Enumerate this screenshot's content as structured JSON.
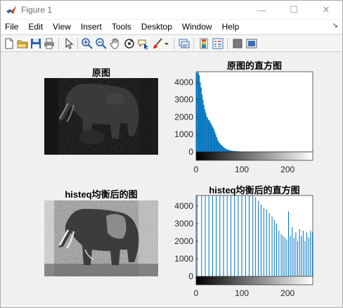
{
  "window": {
    "title": "Figure 1",
    "controls": {
      "minimize": "—",
      "maximize": "☐",
      "close": "✕"
    }
  },
  "menubar": {
    "items": [
      "File",
      "Edit",
      "View",
      "Insert",
      "Tools",
      "Desktop",
      "Window",
      "Help"
    ],
    "dock_arrow": "↘"
  },
  "toolbar": {
    "buttons": [
      "new-figure-icon",
      "open-file-icon",
      "save-icon",
      "print-icon",
      "pointer-icon",
      "zoom-in-icon",
      "zoom-out-icon",
      "pan-hand-icon",
      "rotate-3d-icon",
      "data-cursor-icon",
      "brush-icon",
      "dropdown-arrow-icon",
      "link-plot-icon",
      "colorbar-icon",
      "legend-icon",
      "hide-plot-tools-icon",
      "show-plot-tools-icon"
    ]
  },
  "figure": {
    "titles": {
      "original": "原图",
      "original_hist": "原图的直方图",
      "equalized": "histeq均衡后的图",
      "equalized_hist": "histeq均衡后的直方图"
    },
    "colors": {
      "histogram": "#0072bd",
      "axes": "#262626",
      "background": "#f0f0f0"
    }
  },
  "chart_data": [
    {
      "type": "bar",
      "title": "原图的直方图",
      "xlim": [
        0,
        255
      ],
      "ylim": [
        0,
        4600
      ],
      "xticks": [
        "0",
        "100",
        "200"
      ],
      "yticks": [
        "0",
        "1000",
        "2000",
        "3000",
        "4000"
      ],
      "xticks_values": [
        0,
        100,
        200
      ],
      "yticks_values": [
        0,
        1000,
        2000,
        3000,
        4000
      ],
      "colorbar": "grayscale",
      "series": [
        {
          "x": [
            0,
            2,
            4,
            6,
            8,
            10,
            12,
            14,
            16,
            18,
            20,
            22,
            24,
            26,
            28,
            30,
            32,
            34,
            36,
            38,
            40,
            42,
            44,
            46,
            48,
            50,
            52,
            54,
            56,
            58,
            60,
            62,
            64,
            66,
            68,
            70,
            72,
            74,
            76,
            78,
            80,
            85,
            90,
            95,
            100,
            110,
            120,
            130,
            140
          ],
          "values": [
            4500,
            4600,
            4550,
            4400,
            4000,
            3700,
            3300,
            3000,
            2700,
            2450,
            2250,
            2050,
            1950,
            1850,
            1800,
            1700,
            1600,
            1500,
            1400,
            1300,
            1150,
            1000,
            850,
            700,
            600,
            520,
            450,
            400,
            350,
            300,
            250,
            220,
            180,
            150,
            130,
            110,
            90,
            80,
            70,
            60,
            50,
            40,
            30,
            25,
            20,
            15,
            10,
            8,
            5
          ]
        }
      ]
    },
    {
      "type": "bar",
      "title": "histeq均衡后的直方图",
      "xlim": [
        0,
        255
      ],
      "ylim": [
        0,
        4600
      ],
      "xticks": [
        "0",
        "100",
        "200"
      ],
      "yticks": [
        "0",
        "1000",
        "2000",
        "3000",
        "4000"
      ],
      "xticks_values": [
        0,
        100,
        200
      ],
      "yticks_values": [
        0,
        1000,
        2000,
        3000,
        4000
      ],
      "colorbar": "grayscale",
      "series": [
        {
          "x": [
            2,
            12,
            20,
            28,
            36,
            44,
            52,
            60,
            68,
            76,
            84,
            92,
            100,
            108,
            116,
            124,
            130,
            136,
            142,
            148,
            154,
            160,
            166,
            171,
            176,
            181,
            186,
            190,
            194,
            198,
            202,
            206,
            210,
            214,
            218,
            222,
            226,
            230,
            234,
            238,
            242,
            246,
            250,
            254
          ],
          "values": [
            4600,
            4600,
            4600,
            4600,
            4600,
            4600,
            4600,
            4600,
            4600,
            4600,
            4600,
            4600,
            4600,
            4600,
            4600,
            4600,
            4500,
            4300,
            4100,
            3900,
            3800,
            3600,
            3400,
            3200,
            3000,
            2600,
            2400,
            2300,
            2200,
            2100,
            3700,
            2300,
            2800,
            2200,
            2500,
            2000,
            2700,
            2300,
            2600,
            2000,
            2500,
            2200,
            2600,
            2500
          ]
        }
      ]
    }
  ]
}
